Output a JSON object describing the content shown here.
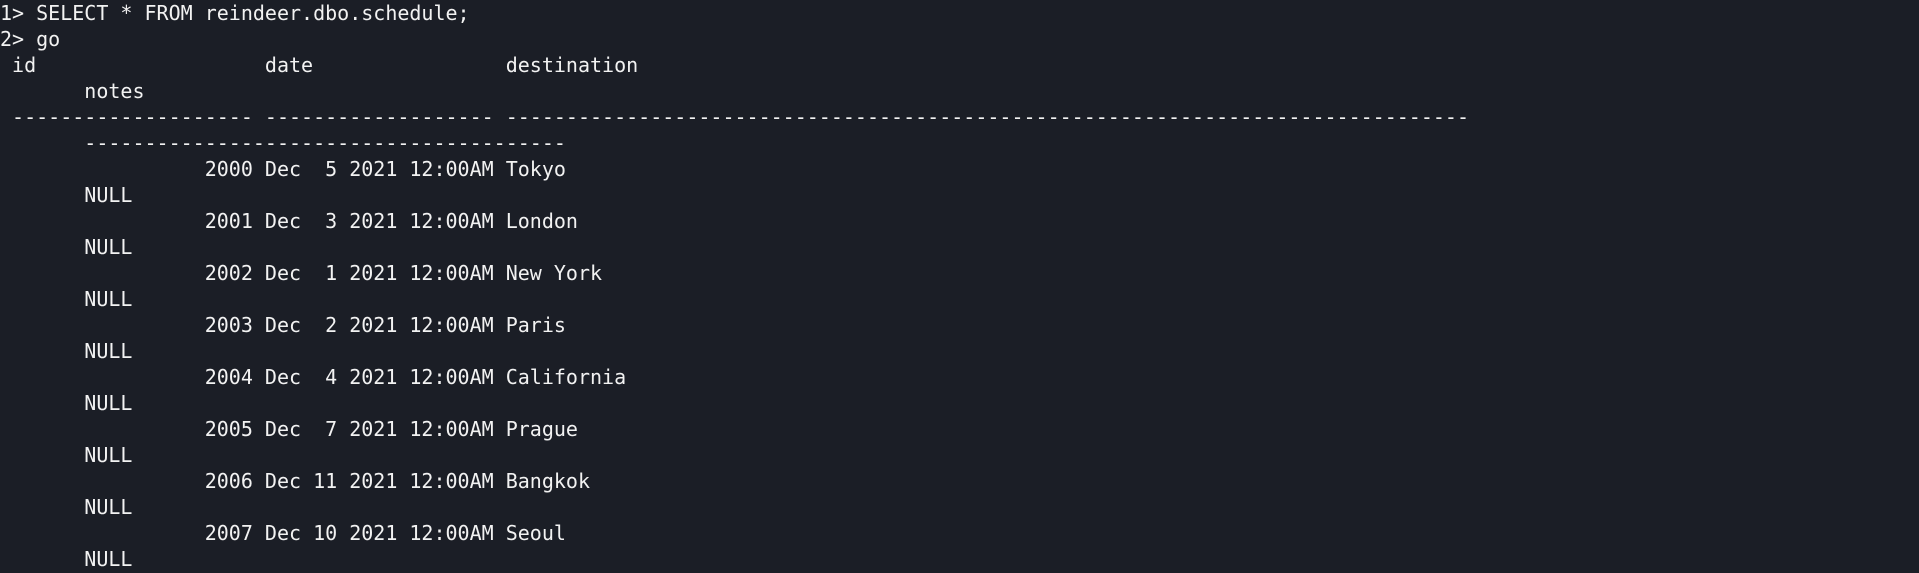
{
  "terminal": {
    "lines": [
      "1> SELECT * FROM reindeer.dbo.schedule;",
      "2> go",
      " id                   date                destination",
      "       notes",
      " -------------------- ------------------- --------------------------------------------------------------------------------",
      "       ----------------------------------------",
      "                 2000 Dec  5 2021 12:00AM Tokyo",
      "       NULL",
      "                 2001 Dec  3 2021 12:00AM London",
      "       NULL",
      "                 2002 Dec  1 2021 12:00AM New York",
      "       NULL",
      "                 2003 Dec  2 2021 12:00AM Paris",
      "       NULL",
      "                 2004 Dec  4 2021 12:00AM California",
      "       NULL",
      "                 2005 Dec  7 2021 12:00AM Prague",
      "       NULL",
      "                 2006 Dec 11 2021 12:00AM Bangkok",
      "       NULL",
      "                 2007 Dec 10 2021 12:00AM Seoul",
      "       NULL"
    ]
  }
}
